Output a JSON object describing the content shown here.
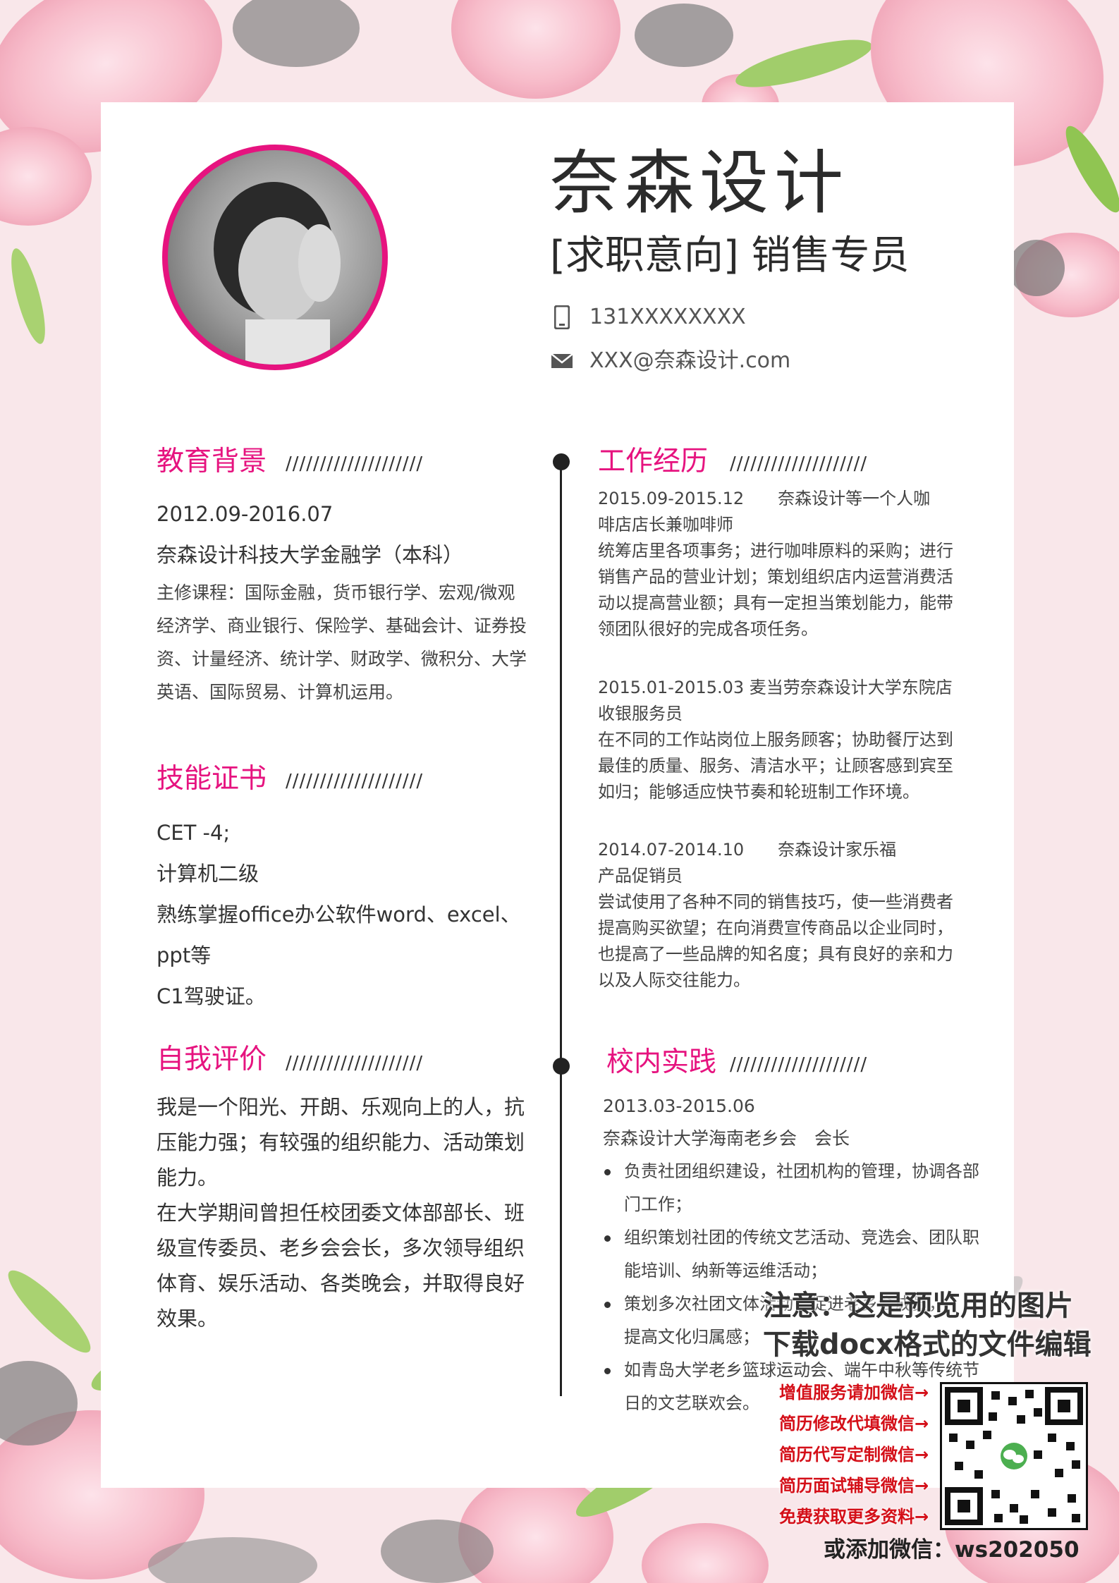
{
  "header": {
    "name": "奈森设计",
    "intent": "[求职意向] 销售专员",
    "phone": "131XXXXXXXX",
    "email": "XXX@奈森设计.com"
  },
  "education": {
    "title": "教育背景",
    "slashes": "////////////////////",
    "period": "2012.09-2016.07",
    "school": "奈森设计科技大学金融学（本科）",
    "courses": [
      "主修课程：国际金融，货币银行学、宏观/微观",
      "经济学、商业银行、保险学、基础会计、证券投",
      "资、计量经济、统计学、财政学、微积分、大学",
      "英语、国际贸易、计算机运用。"
    ]
  },
  "skills": {
    "title": "技能证书",
    "slashes": "////////////////////",
    "items": [
      "CET -4;",
      "计算机二级",
      "熟练掌握office办公软件word、excel、",
      "ppt等",
      "C1驾驶证。"
    ]
  },
  "self": {
    "title": "自我评价",
    "slashes": "////////////////////",
    "lines": [
      "我是一个阳光、开朗、乐观向上的人，抗",
      "压能力强；有较强的组织能力、活动策划",
      "能力。",
      "在大学期间曾担任校团委文体部部长、班",
      "级宣传委员、老乡会会长，多次领导组织",
      "体育、娱乐活动、各类晚会，并取得良好",
      "效果。"
    ]
  },
  "work": {
    "title": "工作经历",
    "slashes": "////////////////////",
    "jobs": [
      {
        "lines": [
          "2015.09-2015.12　　奈森设计等一个人咖",
          "啡店店长兼咖啡师",
          "统筹店里各项事务；进行咖啡原料的采购；进行",
          "销售产品的营业计划；策划组织店内运营消费活",
          "动以提高营业额；具有一定担当策划能力，能带",
          "领团队很好的完成各项任务。"
        ]
      },
      {
        "lines": [
          "2015.01-2015.03  麦当劳奈森设计大学东院店",
          "收银服务员",
          "在不同的工作站岗位上服务顾客；协助餐厅达到",
          "最佳的质量、服务、清洁水平；让顾客感到宾至",
          "如归；能够适应快节奏和轮班制工作环境。"
        ]
      },
      {
        "lines": [
          "2014.07-2014.10　　奈森设计家乐福",
          "产品促销员",
          "尝试使用了各种不同的销售技巧，使一些消费者",
          "提高购买欲望；在向消费宣传商品以企业同时，",
          "也提高了一些品牌的知名度；具有良好的亲和力",
          "以及人际交往能力。"
        ]
      }
    ]
  },
  "campus": {
    "title": "校内实践",
    "slashes": "////////////////////",
    "period": "2013.03-2015.06",
    "org": "奈森设计大学海南老乡会　会长",
    "bullets": [
      [
        "负责社团组织建设，社团机构的管理，协调各部",
        "门工作；"
      ],
      [
        "组织策划社团的传统文艺活动、竞选会、团队职",
        "能培训、纳新等运维活动；"
      ],
      [
        "策划多次社团文体活动，促进老乡会成员，",
        "提高文化归属感；"
      ],
      [
        "如青岛大学老乡篮球运动会、端午中秋等传统节",
        "日的文艺联欢会。"
      ]
    ]
  },
  "watermark": {
    "notice1": "注意：这是预览用的图片",
    "notice2": "下载docx格式的文件编辑",
    "links": [
      "增值服务请加微信→",
      "简历修改代填微信→",
      "简历代写定制微信→",
      "简历面试辅导微信→",
      "免费获取更多资料→"
    ],
    "wechat": "或添加微信：ws202050"
  },
  "colors": {
    "accent": "#e6137f",
    "background": "#f9e7ea",
    "ad_red": "#d40f18"
  },
  "icons": [
    "phone-icon",
    "mail-icon",
    "wechat-icon"
  ]
}
